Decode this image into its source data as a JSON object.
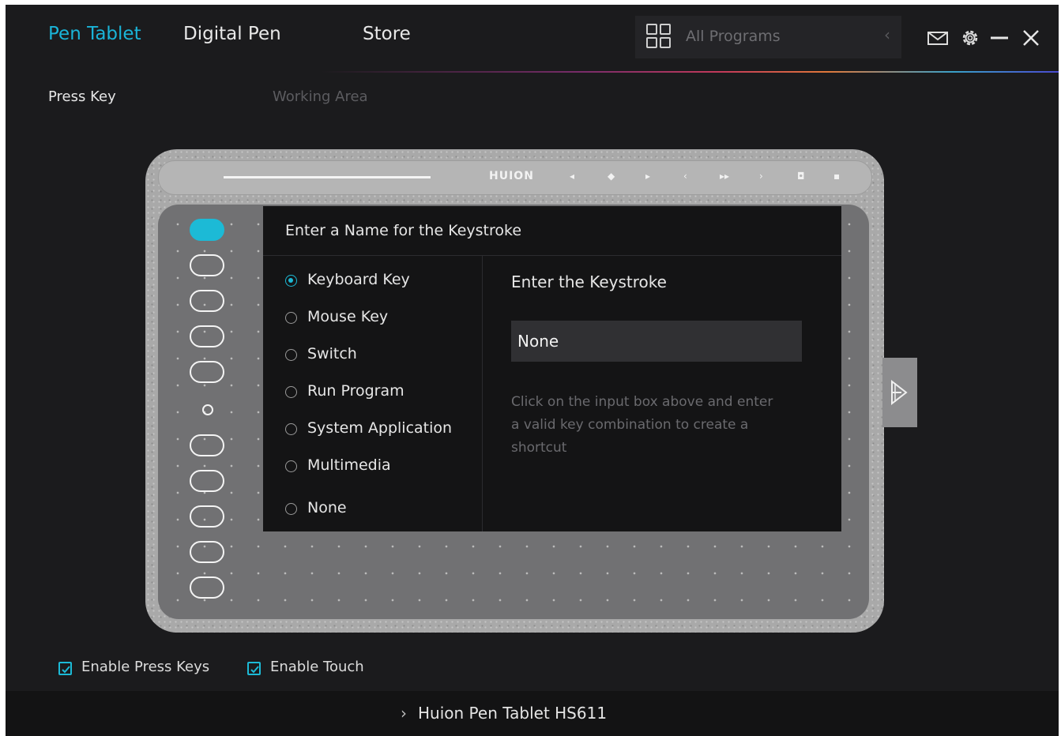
{
  "header": {
    "tabs": [
      {
        "label": "Pen Tablet",
        "active": true
      },
      {
        "label": "Digital Pen",
        "active": false
      },
      {
        "label": "Store",
        "active": false
      }
    ],
    "program_selector": {
      "label": "All Programs",
      "icon": "grid-icon",
      "chevron": "‹"
    },
    "icons": [
      "mail-icon",
      "gear-icon",
      "minimize-icon",
      "close-icon"
    ]
  },
  "subtabs": [
    {
      "label": "Press Key",
      "active": true
    },
    {
      "label": "Working Area",
      "active": false
    }
  ],
  "tablet": {
    "brand": "HUION",
    "selected_key": 1,
    "key_count": 10
  },
  "dialog": {
    "title": "Enter a Name for the Keystroke",
    "options": [
      {
        "label": "Keyboard Key",
        "selected": true
      },
      {
        "label": "Mouse Key",
        "selected": false
      },
      {
        "label": "Switch",
        "selected": false
      },
      {
        "label": "Run Program",
        "selected": false
      },
      {
        "label": "System Application",
        "selected": false
      },
      {
        "label": "Multimedia",
        "selected": false
      },
      {
        "label": "None",
        "selected": false
      }
    ],
    "keystroke_title": "Enter the Keystroke",
    "keystroke_value": "None",
    "hint": "Click on the input box above and enter a valid key combination to create a shortcut"
  },
  "checkboxes": [
    {
      "label": "Enable Press Keys",
      "checked": true
    },
    {
      "label": "Enable Touch",
      "checked": true
    }
  ],
  "footer": {
    "device": "Huion Pen Tablet HS611",
    "chevron": "›"
  },
  "colors": {
    "accent": "#1ab4d8",
    "background": "#1b1b1d",
    "dialog": "#141415"
  }
}
